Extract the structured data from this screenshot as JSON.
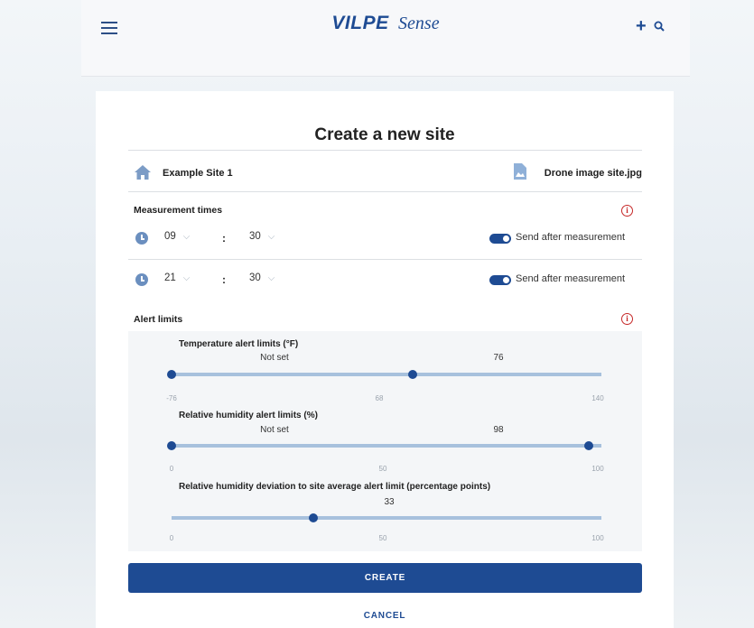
{
  "header": {
    "brand": "VILPE",
    "product": "Sense",
    "add_symbol": "+",
    "icons": [
      "menu-icon",
      "plus-icon",
      "search-icon"
    ]
  },
  "page": {
    "title": "Create a new site"
  },
  "site": {
    "name": "Example Site 1",
    "image_name": "Drone image site.jpg"
  },
  "measurement": {
    "label": "Measurement times",
    "rows": [
      {
        "hour": "09",
        "minute": "30",
        "colon": ":",
        "toggle_on": true,
        "toggle_label": "Send after measurement"
      },
      {
        "hour": "21",
        "minute": "30",
        "colon": ":",
        "toggle_on": true,
        "toggle_label": "Send after measurement"
      }
    ]
  },
  "alerts": {
    "label": "Alert limits",
    "info_symbol": "i",
    "sliders": [
      {
        "title": "Temperature alert limits (°F)",
        "low_label": "Not set",
        "high_label": "76",
        "min": "-76",
        "mid": "68",
        "max": "140",
        "low_value": -76,
        "high_value": 76
      },
      {
        "title": "Relative humidity alert limits (%)",
        "low_label": "Not set",
        "high_label": "98",
        "min": "0",
        "mid": "50",
        "max": "100",
        "low_value": 0,
        "high_value": 98
      },
      {
        "title": "Relative humidity deviation to site average alert limit (percentage points)",
        "value_label": "33",
        "min": "0",
        "mid": "50",
        "max": "100",
        "value": 33
      }
    ]
  },
  "actions": {
    "create": "CREATE",
    "cancel": "CANCEL"
  },
  "colors": {
    "accent": "#1e4b93",
    "track": "#a7c1dd",
    "info": "#c62828"
  }
}
